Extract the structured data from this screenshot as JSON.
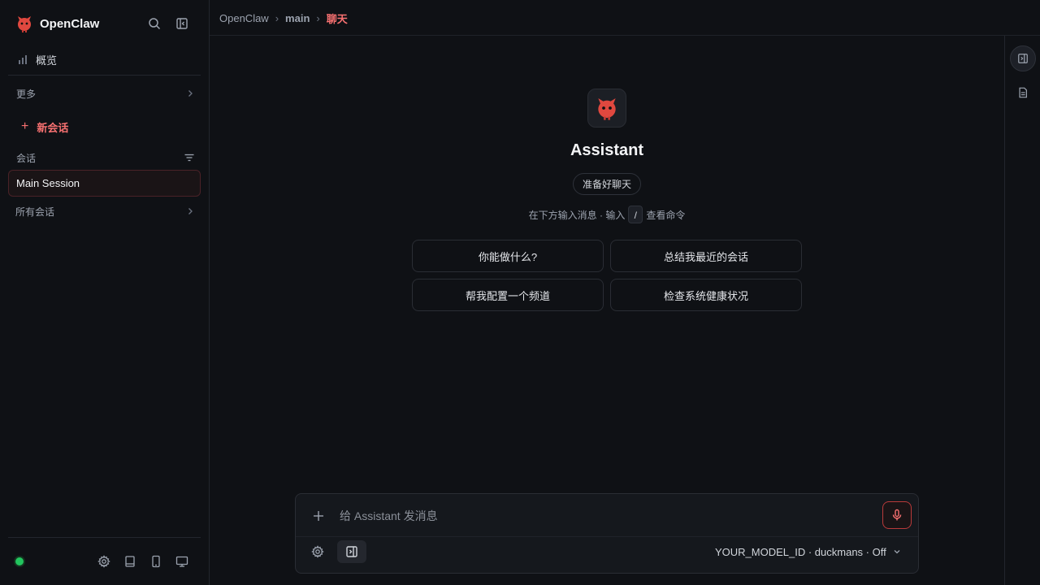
{
  "brand": {
    "name": "OpenClaw"
  },
  "sidebar": {
    "overview_label": "概览",
    "more_label": "更多",
    "new_chat_label": "新会话",
    "sessions_label": "会话",
    "sessions": [
      {
        "label": "Main Session",
        "active": true
      }
    ],
    "all_sessions_label": "所有会话",
    "status": "online"
  },
  "breadcrumb": {
    "root": "OpenClaw",
    "agent": "main",
    "current": "聊天"
  },
  "welcome": {
    "name": "Assistant",
    "badge": "准备好聊天",
    "hint_before": "在下方输入消息 · 输入",
    "hint_key": "/",
    "hint_after": "查看命令",
    "suggestions": [
      "你能做什么?",
      "总结我最近的会话",
      "帮我配置一个频道",
      "检查系统健康状况"
    ]
  },
  "composer": {
    "placeholder": "给 Assistant 发消息",
    "value": "",
    "model_label": "YOUR_MODEL_ID · duckmans · Off"
  },
  "colors": {
    "accent": "#f87171",
    "status": "#22c55e",
    "background": "#0f1115"
  },
  "icons": [
    "claw-logo-icon",
    "search-icon",
    "sidebar-toggle-icon",
    "bar-chart-icon",
    "chevron-right-icon",
    "plus-icon",
    "filter-icon",
    "gear-icon",
    "book-icon",
    "tablet-icon",
    "monitor-icon",
    "panel-icon",
    "document-icon",
    "mic-icon",
    "chevron-down-icon"
  ]
}
